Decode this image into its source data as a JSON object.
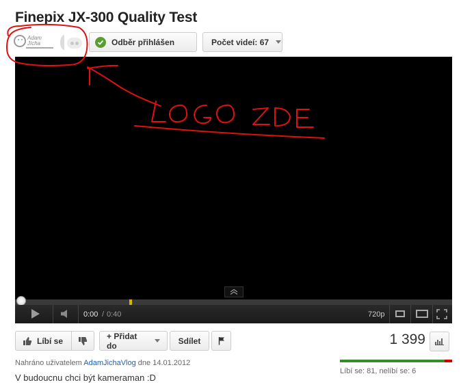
{
  "video": {
    "title": "Finepix JX-300 Quality Test",
    "current_time": "0:00",
    "separator": "/",
    "duration": "0:40",
    "quality": "720p",
    "progress_fraction": 0.0,
    "buffered_marker_fraction": 0.26
  },
  "channel": {
    "logo_text_line1": "Adam",
    "logo_text_line2": "Jícha",
    "subscribe_label": "Odběr přihlášen",
    "video_count_label": "Počet videí: 67"
  },
  "actions": {
    "like_label": "Líbí se",
    "add_label": "+ Přidat do",
    "share_label": "Sdílet"
  },
  "stats": {
    "views": "1 399",
    "rating_text": "Líbí se: 81, nelíbí se: 6",
    "likes": 81,
    "dislikes": 6
  },
  "upload": {
    "prefix": "Nahráno uživatelem",
    "user": "AdamJichaVlog",
    "date_text": "dne 14.01.2012"
  },
  "description": "V budoucnu chci být kameraman :D",
  "annotation": {
    "text": "LOGO ZDE",
    "color": "#e01010"
  },
  "colors": {
    "subscribed_check": "#5a9e2f",
    "link": "#1c62b9",
    "rating_positive": "#3a8a2e",
    "rating_negative": "#cc0000",
    "progress_marker": "#d8b100"
  },
  "icons": {
    "subscribe": "check-icon",
    "like": "thumbs-up-icon",
    "dislike": "thumbs-down-icon",
    "flag": "flag-icon",
    "stats": "bar-chart-icon",
    "play": "play-icon",
    "volume": "volume-icon",
    "expand": "chevron-up-icon"
  }
}
